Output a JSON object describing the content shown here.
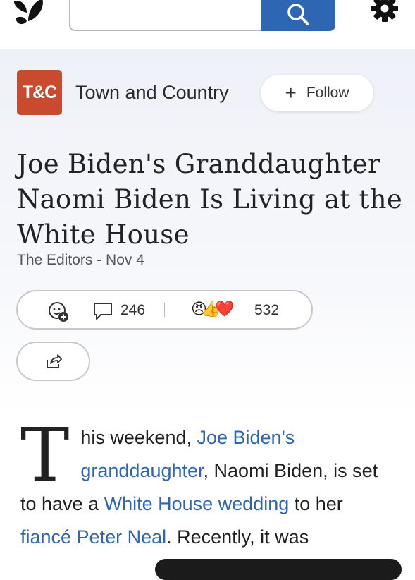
{
  "search": {
    "value": ""
  },
  "publisher": {
    "logo_text": "T&C",
    "name": "Town and Country",
    "follow_label": "Follow"
  },
  "article": {
    "headline": "Joe Biden's Granddaughter Naomi Biden Is Living at the White House",
    "byline": "The Editors - Nov 4",
    "comment_count": "246",
    "reaction_count": "532",
    "reaction_emojis": "😠👍❤️",
    "body": {
      "drop_cap": "T",
      "seg1": "his weekend, ",
      "link1": "Joe Biden's granddaughter",
      "seg2": ", Naomi Biden, is set to have a ",
      "link2": "White House wedding",
      "seg3": " to her ",
      "link3": "fiancé Peter Neal",
      "seg4": ". Recently, it was"
    }
  },
  "icons": [
    "msn-butterfly-logo-icon",
    "search-icon",
    "gear-icon",
    "plus-icon",
    "add-reaction-icon",
    "comment-icon",
    "share-icon"
  ],
  "colors": {
    "accent": "#2f66b3",
    "publisher_logo": "#c84a2f"
  }
}
